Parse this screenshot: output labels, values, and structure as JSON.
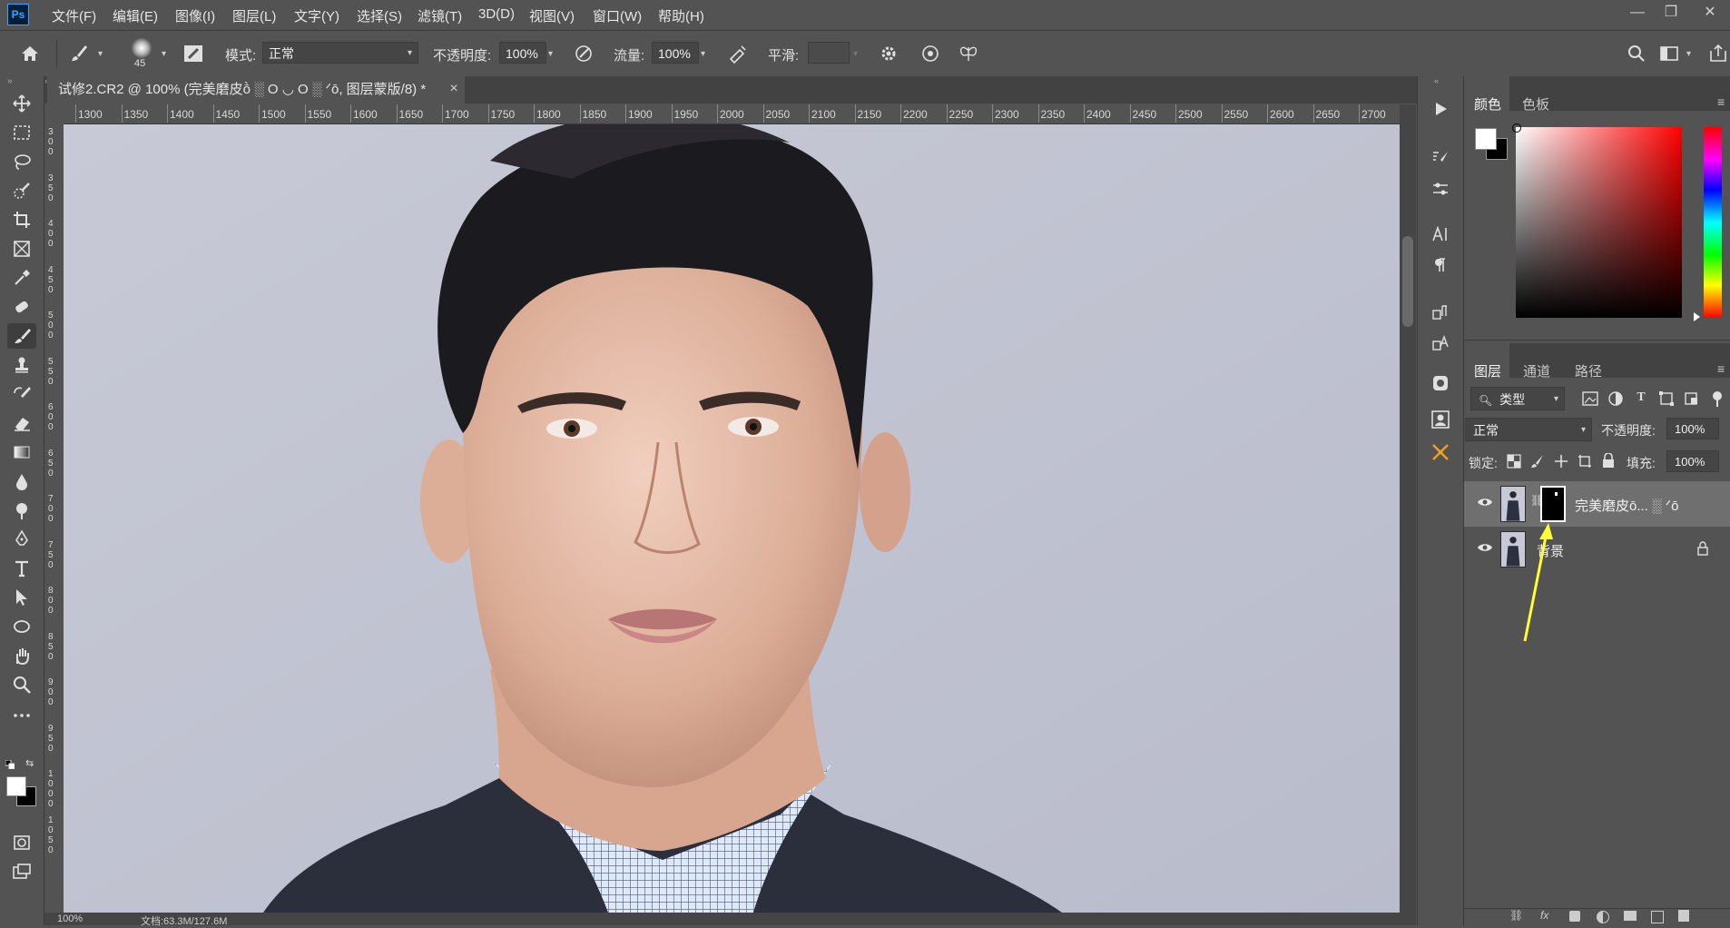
{
  "app": {
    "logo": "Ps"
  },
  "menu": [
    "文件(F)",
    "编辑(E)",
    "图像(I)",
    "图层(L)",
    "文字(Y)",
    "选择(S)",
    "滤镜(T)",
    "3D(D)",
    "视图(V)",
    "窗口(W)",
    "帮助(H)"
  ],
  "window_controls": {
    "minimize": "—",
    "restore": "❐",
    "close": "✕"
  },
  "options": {
    "brush_size": "45",
    "mode_label": "模式:",
    "mode_value": "正常",
    "opacity_label": "不透明度:",
    "opacity_value": "100%",
    "flow_label": "流量:",
    "flow_value": "100%",
    "smoothing_label": "平滑:",
    "smoothing_value": ""
  },
  "document": {
    "tab_title": "试修2.CR2 @ 100% (完美磨皮ṑ ░ O ◡ O ░ ᐟō, 图层蒙版/8) *",
    "close": "×",
    "ruler_marks": [
      "1300",
      "1350",
      "1400",
      "1450",
      "1500",
      "1550",
      "1600",
      "1650",
      "1700",
      "1750",
      "1800",
      "1850",
      "1900",
      "1950",
      "2000",
      "2050",
      "2100",
      "2150",
      "2200",
      "2250",
      "2300",
      "2350",
      "2400",
      "2450",
      "2500",
      "2550",
      "2600",
      "2650",
      "2700"
    ],
    "left_ruler_marks": [
      "3\n0\n0",
      "3\n5\n0",
      "4\n0\n0",
      "4\n5\n0",
      "5\n0\n0",
      "5\n5\n0",
      "6\n0\n0",
      "6\n5\n0",
      "7\n0\n0",
      "7\n5\n0",
      "8\n0\n0",
      "8\n5\n0",
      "9\n0\n0",
      "9\n5\n0",
      "1\n0\n0\n0",
      "1\n0\n5\n0"
    ],
    "status_zoom": "100%",
    "status_doc": "文档:63.3M/127.6M"
  },
  "color_panel": {
    "tabs": [
      "颜色",
      "色板"
    ],
    "foreground": "#ffffff",
    "background": "#000000"
  },
  "layers_panel": {
    "tabs": [
      "图层",
      "通道",
      "路径"
    ],
    "filter_label": "类型",
    "blend_mode": "正常",
    "opacity_label": "不透明度:",
    "opacity_value": "100%",
    "lock_label": "锁定:",
    "fill_label": "填充:",
    "fill_value": "100%",
    "layers": [
      {
        "name": "完美磨皮ō... ░ ᐟō",
        "has_mask": true,
        "selected": true
      },
      {
        "name": "背景",
        "has_mask": false,
        "selected": false,
        "locked": true
      }
    ]
  },
  "annotation": {
    "arrow_color": "#ffff33"
  }
}
